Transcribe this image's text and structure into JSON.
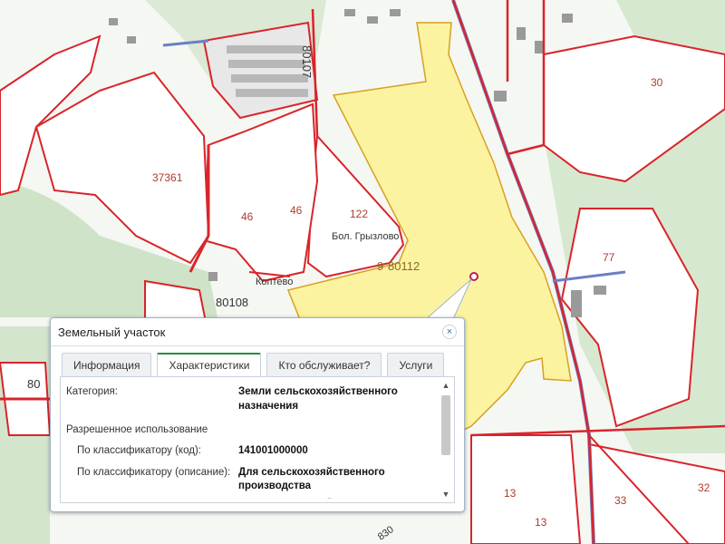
{
  "map": {
    "parcel_numbers": [
      "80107",
      "80112",
      "80108",
      "80"
    ],
    "area_labels": [
      "37361",
      "46",
      "46",
      "122",
      "30",
      "77",
      "13",
      "13",
      "33",
      "32",
      "830"
    ],
    "place_labels": [
      "Бол. Грызлово",
      "Коптево"
    ],
    "selected_marker_label": "9",
    "colors": {
      "boundary": "#d9242b",
      "selected_parcel": "#fbf3a0",
      "forest": "#cfe3c8",
      "road_blue": "#6b7fc4"
    }
  },
  "popup": {
    "title": "Земельный участок",
    "close_glyph": "×",
    "tabs": [
      {
        "label": "Информация",
        "active": false
      },
      {
        "label": "Характеристики",
        "active": true
      },
      {
        "label": "Кто обслуживает?",
        "active": false
      },
      {
        "label": "Услуги",
        "active": false
      }
    ],
    "category_label": "Категория:",
    "category_value_line1": "Земли сельскохозяйственного",
    "category_value_line2": "назначения",
    "permitted_use_label": "Разрешенное использование",
    "classifier_code_label": "По классификатору (код):",
    "classifier_code_value": "141001000000",
    "classifier_desc_label": "По классификатору (описание):",
    "classifier_desc_line1": "Для сельскохозяйственного",
    "classifier_desc_line2": "производства",
    "more_indicator": "..",
    "scroll_up_glyph": "▲",
    "scroll_down_glyph": "▼"
  }
}
